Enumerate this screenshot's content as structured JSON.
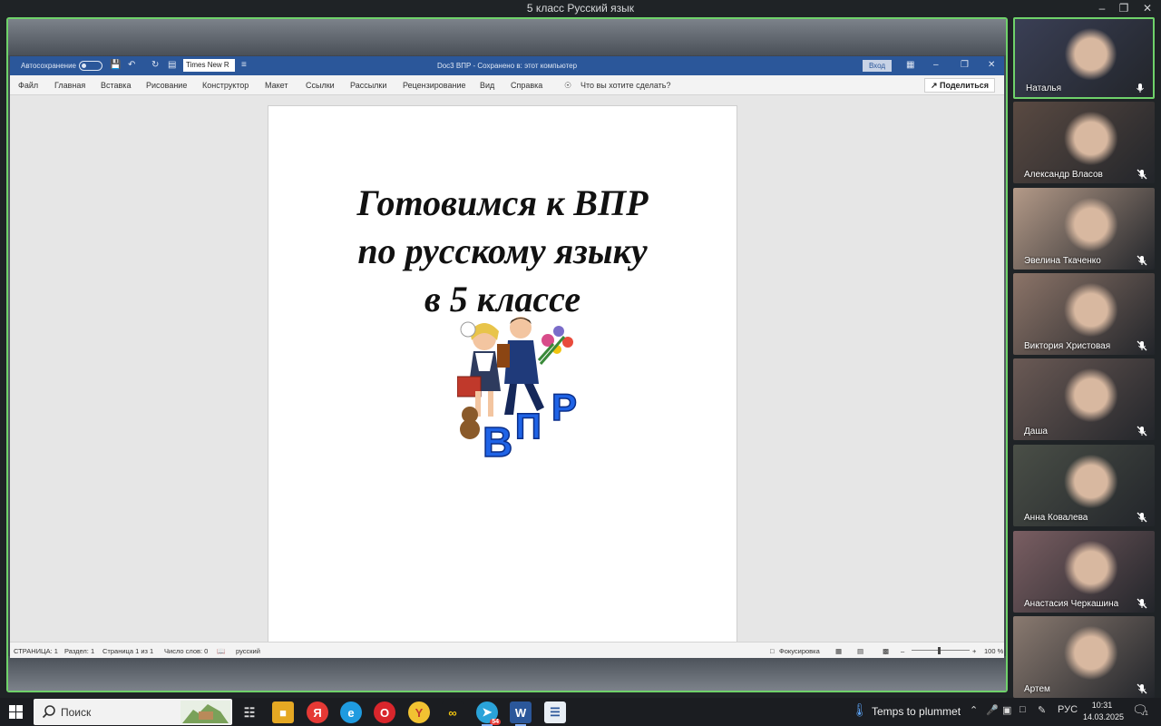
{
  "window": {
    "title": "5 класс Русский язык"
  },
  "word": {
    "autosave_label": "Автосохранение",
    "font_name": "Times New R",
    "doc_title": "Doc3 ВПР  -  Сохранено в: этот компьютер",
    "signin_label": "Вход",
    "ribbon_tabs": [
      "Файл",
      "Главная",
      "Вставка",
      "Рисование",
      "Конструктор",
      "Макет",
      "Ссылки",
      "Рассылки",
      "Рецензирование",
      "Вид",
      "Справка"
    ],
    "tell_me": "Что вы хотите сделать?",
    "share_label": "Поделиться",
    "heading_lines": [
      "Готовимся к ВПР",
      "по русскому языку",
      "в 5 классе"
    ],
    "illustration_text": "ВПР",
    "status": {
      "page": "СТРАНИЦА: 1",
      "section": "Раздел: 1",
      "page_of": "Страница 1 из 1",
      "words": "Число слов: 0",
      "language": "русский",
      "focus": "Фокусировка",
      "zoom": "100 %"
    }
  },
  "participants": [
    {
      "name": "Наталья",
      "mic": "on",
      "bg": "#3a3f55"
    },
    {
      "name": "Александр Власов",
      "mic": "off",
      "bg": "#5a4a42"
    },
    {
      "name": "Эвелина Ткаченко",
      "mic": "off",
      "bg": "#b49a88"
    },
    {
      "name": "Виктория Христовая",
      "mic": "off",
      "bg": "#8c7468"
    },
    {
      "name": "Даша",
      "mic": "off",
      "bg": "#6b5a55"
    },
    {
      "name": "Анна Ковалева",
      "mic": "off",
      "bg": "#4a4f47"
    },
    {
      "name": "Анастасия Черкашина",
      "mic": "off",
      "bg": "#7a5e62"
    },
    {
      "name": "Артем",
      "mic": "off",
      "bg": "#8a7a70"
    }
  ],
  "taskbar": {
    "search_label": "Поиск",
    "weather": "Temps to plummet",
    "lang": "РУС",
    "time": "10:31",
    "date": "14.03.2025",
    "telegram_badge": "54",
    "notif_count": "1"
  },
  "colors": {
    "accent_green": "#6fd26a",
    "word_blue": "#2b579a",
    "vpr_blue": "#1f63e6"
  }
}
